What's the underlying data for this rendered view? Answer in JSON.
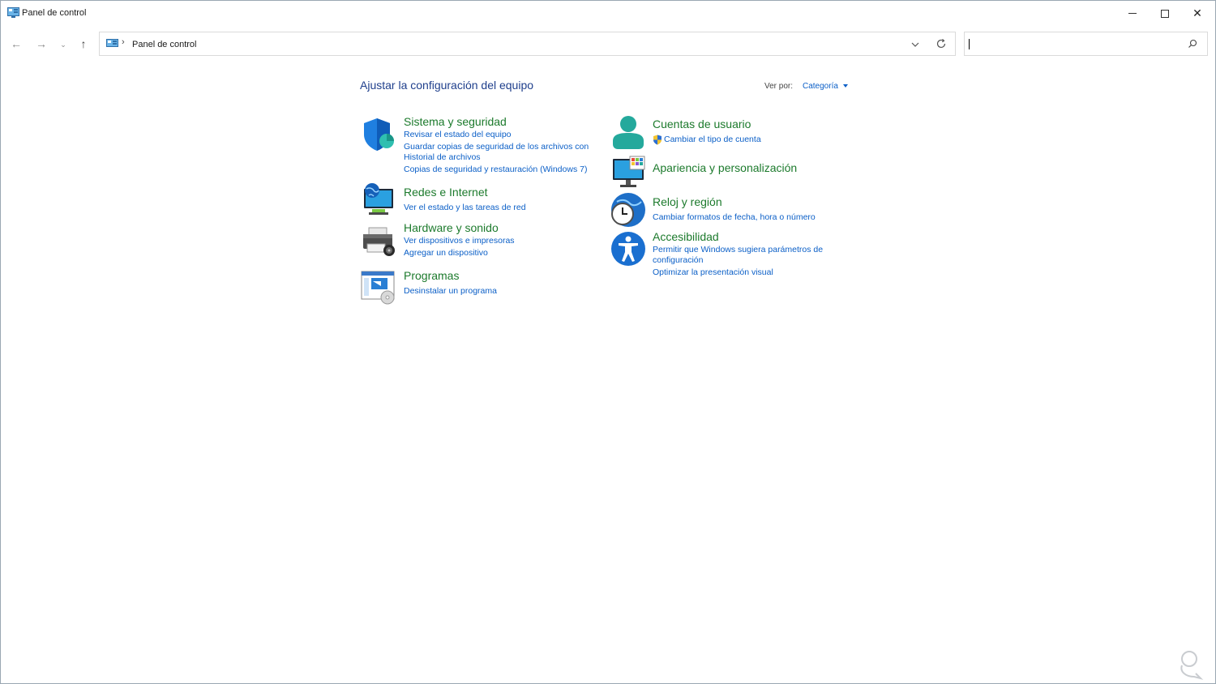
{
  "window": {
    "title": "Panel de control",
    "minimize_icon": "minimize-icon",
    "maximize_icon": "maximize-icon",
    "close_label": "✕"
  },
  "nav": {
    "back": "←",
    "forward": "→",
    "recent": "⌄",
    "up": "↑"
  },
  "address": {
    "separator": "›",
    "path": "Panel de control"
  },
  "search": {
    "value": "",
    "placeholder": ""
  },
  "content": {
    "title": "Ajustar la configuración del equipo",
    "view_by_label": "Ver por:",
    "view_by_value": "Categoría"
  },
  "categories": [
    {
      "title": "Sistema y seguridad",
      "icon": "shield-icon",
      "links": [
        "Revisar el estado del equipo",
        "Guardar copias de seguridad de los archivos con",
        "Historial de archivos",
        "Copias de seguridad y restauración (Windows 7)"
      ]
    },
    {
      "title": "Redes e Internet",
      "icon": "network-icon",
      "links": [
        "Ver el estado y las tareas de red"
      ]
    },
    {
      "title": "Hardware y sonido",
      "icon": "printer-icon",
      "links": [
        "Ver dispositivos e impresoras",
        "Agregar un dispositivo"
      ]
    },
    {
      "title": "Programas",
      "icon": "programs-icon",
      "links": [
        "Desinstalar un programa"
      ]
    },
    {
      "title": "Cuentas de usuario",
      "icon": "user-icon",
      "links": [
        "Cambiar el tipo de cuenta"
      ]
    },
    {
      "title": "Apariencia y personalización",
      "icon": "appearance-icon",
      "links": []
    },
    {
      "title": "Reloj y región",
      "icon": "clock-globe-icon",
      "links": [
        "Cambiar formatos de fecha, hora o número"
      ]
    },
    {
      "title": "Accesibilidad",
      "icon": "accessibility-icon",
      "links": [
        "Permitir que Windows sugiera parámetros de",
        "configuración",
        "Optimizar la presentación visual"
      ]
    }
  ],
  "colors": {
    "category_title": "#1c7a2c",
    "link": "#0b5fc7",
    "heading": "#1f3f8c"
  }
}
